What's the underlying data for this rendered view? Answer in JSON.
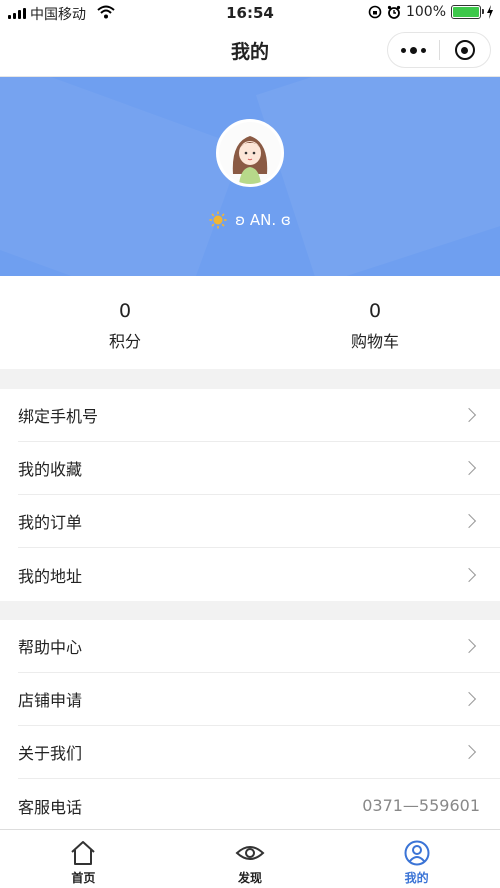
{
  "status_bar": {
    "carrier": "中国移动",
    "time": "16:54",
    "battery": "100%",
    "battery_level": 1.0
  },
  "nav": {
    "title": "我的"
  },
  "profile": {
    "nickname": "ʚ AN. ɞ"
  },
  "stats": [
    {
      "value": "0",
      "label": "积分"
    },
    {
      "value": "0",
      "label": "购物车"
    }
  ],
  "menu_group_1": [
    {
      "label": "绑定手机号"
    },
    {
      "label": "我的收藏"
    },
    {
      "label": "我的订单"
    },
    {
      "label": "我的地址"
    }
  ],
  "menu_group_2": [
    {
      "label": "帮助中心"
    },
    {
      "label": "店铺申请"
    },
    {
      "label": "关于我们"
    },
    {
      "label": "客服电话",
      "value": "0371—559601"
    }
  ],
  "tabbar": [
    {
      "label": "首页",
      "icon": "home-icon"
    },
    {
      "label": "发现",
      "icon": "eye-icon"
    },
    {
      "label": "我的",
      "icon": "user-icon",
      "active": true
    }
  ],
  "colors": {
    "banner": "#6f9ff0",
    "active_tab": "#3b74d6",
    "battery": "#3dc84a"
  }
}
